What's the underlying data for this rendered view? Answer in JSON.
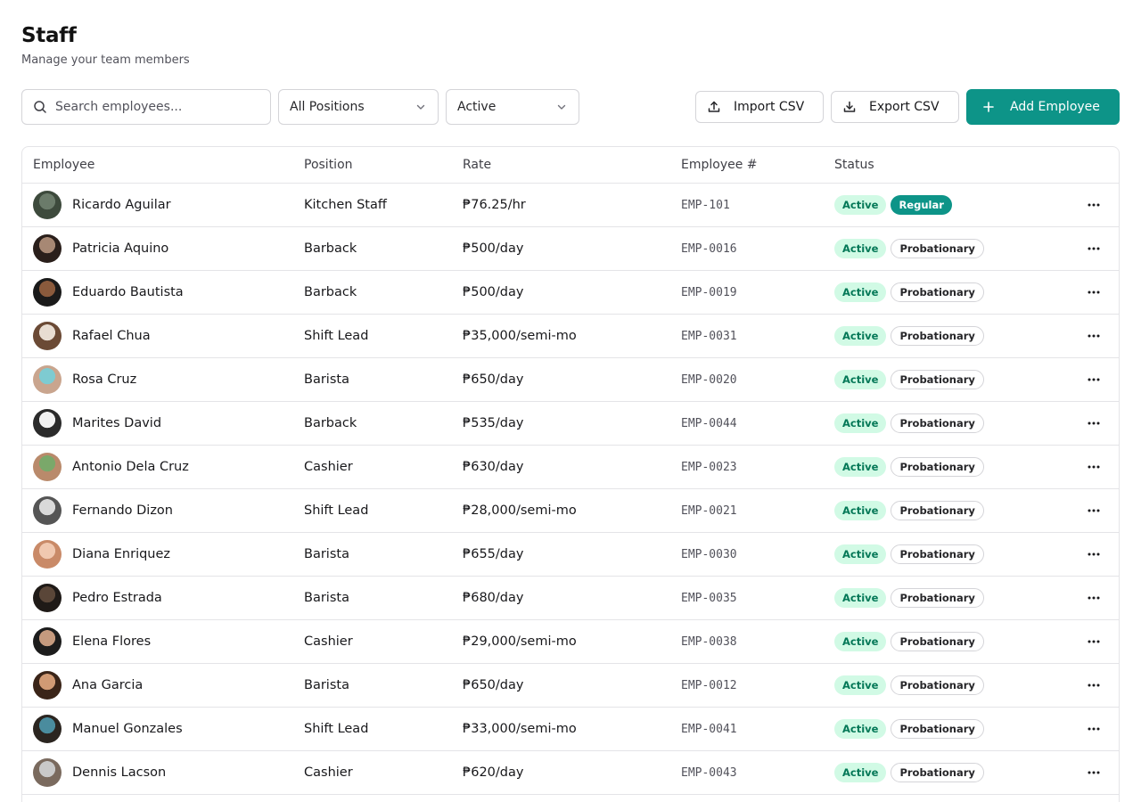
{
  "header": {
    "title": "Staff",
    "subtitle": "Manage your team members"
  },
  "toolbar": {
    "search_placeholder": "Search employees...",
    "position_filter": "All Positions",
    "status_filter": "Active",
    "import_label": "Import CSV",
    "export_label": "Export CSV",
    "add_label": "Add Employee"
  },
  "colors": {
    "accent": "#0d9488",
    "active_badge_bg": "#d1fae5",
    "active_badge_text": "#047857"
  },
  "table": {
    "headers": [
      "Employee",
      "Position",
      "Rate",
      "Employee #",
      "Status"
    ],
    "rows": [
      {
        "name": "Ricardo Aguilar",
        "position": "Kitchen Staff",
        "rate": "₱76.25/hr",
        "number": "EMP-101",
        "status": "Active",
        "type": "Regular",
        "avatar": [
          "#6b7b6a",
          "#3d4a3c"
        ]
      },
      {
        "name": "Patricia Aquino",
        "position": "Barback",
        "rate": "₱500/day",
        "number": "EMP-0016",
        "status": "Active",
        "type": "Probationary",
        "avatar": [
          "#a78874",
          "#2a1f1b"
        ]
      },
      {
        "name": "Eduardo Bautista",
        "position": "Barback",
        "rate": "₱500/day",
        "number": "EMP-0019",
        "status": "Active",
        "type": "Probationary",
        "avatar": [
          "#8a5a3c",
          "#1a1a1a"
        ]
      },
      {
        "name": "Rafael Chua",
        "position": "Shift Lead",
        "rate": "₱35,000/semi-mo",
        "number": "EMP-0031",
        "status": "Active",
        "type": "Probationary",
        "avatar": [
          "#e8ddd2",
          "#6b4a35"
        ]
      },
      {
        "name": "Rosa Cruz",
        "position": "Barista",
        "rate": "₱650/day",
        "number": "EMP-0020",
        "status": "Active",
        "type": "Probationary",
        "avatar": [
          "#7ecbd1",
          "#c9a58e"
        ]
      },
      {
        "name": "Marites David",
        "position": "Barback",
        "rate": "₱535/day",
        "number": "EMP-0044",
        "status": "Active",
        "type": "Probationary",
        "avatar": [
          "#f2f2f2",
          "#2b2b2b"
        ]
      },
      {
        "name": "Antonio Dela Cruz",
        "position": "Cashier",
        "rate": "₱630/day",
        "number": "EMP-0023",
        "status": "Active",
        "type": "Probationary",
        "avatar": [
          "#7aa86a",
          "#b98a6b"
        ]
      },
      {
        "name": "Fernando Dizon",
        "position": "Shift Lead",
        "rate": "₱28,000/semi-mo",
        "number": "EMP-0021",
        "status": "Active",
        "type": "Probationary",
        "avatar": [
          "#d9d9d9",
          "#555555"
        ]
      },
      {
        "name": "Diana Enriquez",
        "position": "Barista",
        "rate": "₱655/day",
        "number": "EMP-0030",
        "status": "Active",
        "type": "Probationary",
        "avatar": [
          "#f0c8b0",
          "#c98a68"
        ]
      },
      {
        "name": "Pedro Estrada",
        "position": "Barista",
        "rate": "₱680/day",
        "number": "EMP-0035",
        "status": "Active",
        "type": "Probationary",
        "avatar": [
          "#5a4638",
          "#1f1a17"
        ]
      },
      {
        "name": "Elena Flores",
        "position": "Cashier",
        "rate": "₱29,000/semi-mo",
        "number": "EMP-0038",
        "status": "Active",
        "type": "Probationary",
        "avatar": [
          "#c59a7e",
          "#1c1c1c"
        ]
      },
      {
        "name": "Ana Garcia",
        "position": "Barista",
        "rate": "₱650/day",
        "number": "EMP-0012",
        "status": "Active",
        "type": "Probationary",
        "avatar": [
          "#d19a74",
          "#3a2418"
        ]
      },
      {
        "name": "Manuel Gonzales",
        "position": "Shift Lead",
        "rate": "₱33,000/semi-mo",
        "number": "EMP-0041",
        "status": "Active",
        "type": "Probationary",
        "avatar": [
          "#4a8c9e",
          "#2b2520"
        ]
      },
      {
        "name": "Dennis Lacson",
        "position": "Cashier",
        "rate": "₱620/day",
        "number": "EMP-0043",
        "status": "Active",
        "type": "Probationary",
        "avatar": [
          "#c9c9c9",
          "#7a6a5e"
        ]
      }
    ]
  }
}
